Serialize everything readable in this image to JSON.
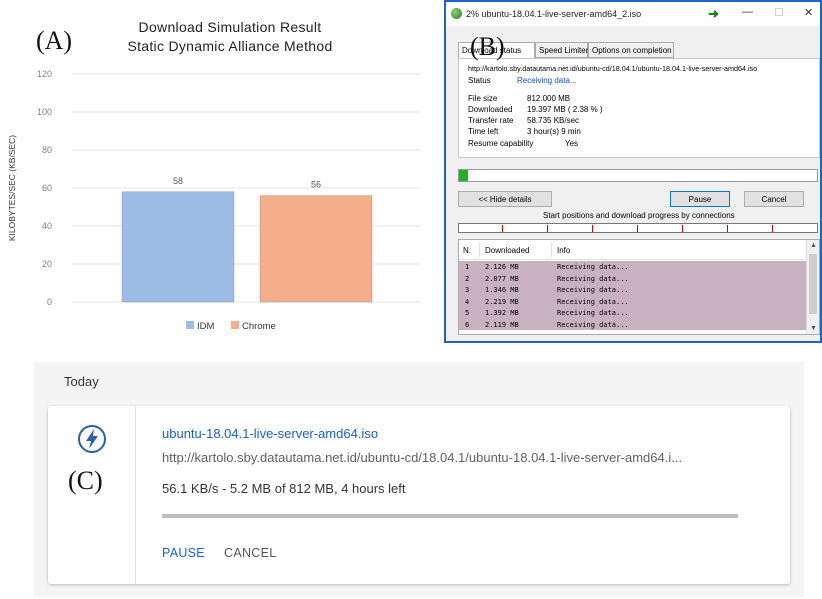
{
  "panel_labels": {
    "a": "(A)",
    "b": "(B)",
    "c": "(C)"
  },
  "chart_data": {
    "type": "bar",
    "title": [
      "Download Simulation Result",
      "Static Dynamic Alliance Method"
    ],
    "ylabel": "KILOBYTES/SEC (KB/SEC)",
    "xlabel": "",
    "ylim": [
      0,
      120
    ],
    "yticks": [
      0,
      20,
      40,
      60,
      80,
      100,
      120
    ],
    "grid": true,
    "legend_position": "bottom",
    "series": [
      {
        "name": "IDM",
        "value": 58,
        "color": "#9dbde6"
      },
      {
        "name": "Chrome",
        "value": 56,
        "color": "#f4ae8c"
      }
    ]
  },
  "idm": {
    "title": "2% ubuntu-18.04.1-live-server-amd64_2.iso",
    "window_controls": {
      "minimize": "—",
      "maximize": "☐",
      "close": "✕"
    },
    "tabs": [
      "Download status",
      "Speed Limiter",
      "Options on completion"
    ],
    "url": "http://kartolo.sby.datautama.net.id/ubuntu-cd/18.04.1/ubuntu-18.04.1-live-server-amd64.iso",
    "status_label": "Status",
    "status_value": "Receiving data...",
    "fields": [
      {
        "label": "File size",
        "value": "812.000  MB"
      },
      {
        "label": "Downloaded",
        "value": "19.397  MB  ( 2.38 % )"
      },
      {
        "label": "Transfer rate",
        "value": "58.735  KB/sec"
      },
      {
        "label": "Time left",
        "value": "3 hour(s) 9 min"
      },
      {
        "label": "Resume capability",
        "value": "Yes"
      }
    ],
    "progress": 0.0238,
    "buttons": {
      "hide_details": "<< Hide details",
      "pause": "Pause",
      "cancel": "Cancel"
    },
    "connections_caption": "Start positions and download progress by connections",
    "table_headers": [
      "N.",
      "Downloaded",
      "Info"
    ],
    "connections": [
      {
        "n": "1",
        "downloaded": "2.126 MB",
        "info": "Receiving data..."
      },
      {
        "n": "2",
        "downloaded": "2.077 MB",
        "info": "Receiving data..."
      },
      {
        "n": "3",
        "downloaded": "1.346 MB",
        "info": "Receiving data..."
      },
      {
        "n": "4",
        "downloaded": "2.219 MB",
        "info": "Receiving data..."
      },
      {
        "n": "5",
        "downloaded": "1.392 MB",
        "info": "Receiving data..."
      },
      {
        "n": "6",
        "downloaded": "2.119 MB",
        "info": "Receiving data..."
      }
    ]
  },
  "chrome": {
    "section": "Today",
    "filename": "ubuntu-18.04.1-live-server-amd64.iso",
    "url": "http://kartolo.sby.datautama.net.id/ubuntu-cd/18.04.1/ubuntu-18.04.1-live-server-amd64.i...",
    "status": "56.1 KB/s - 5.2 MB of 812 MB, 4 hours left",
    "progress": 0.0064,
    "pause_label": "PAUSE",
    "cancel_label": "CANCEL",
    "accent_color": "#1a5fc4"
  }
}
